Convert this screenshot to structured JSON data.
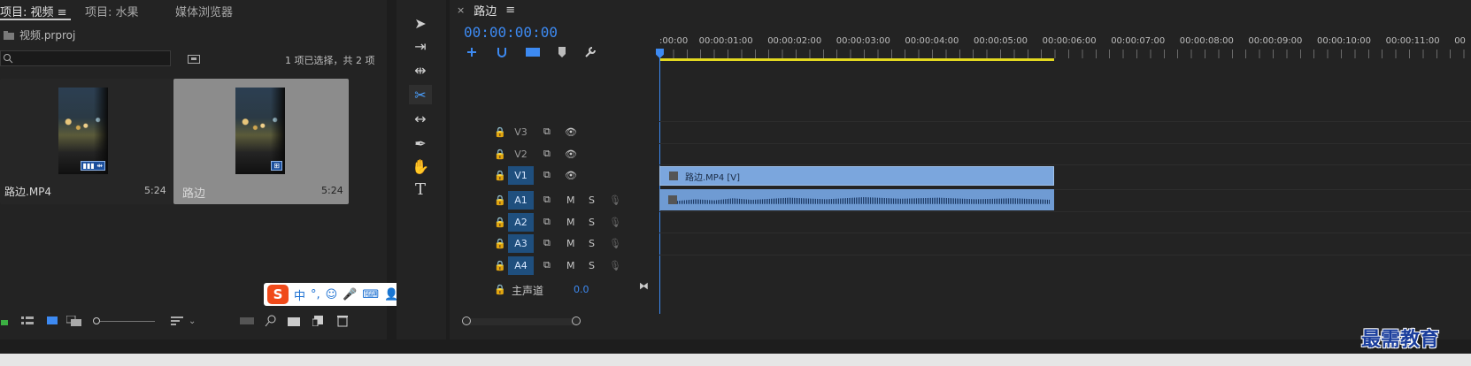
{
  "left_panel": {
    "tabs": [
      {
        "label": "项目: 视频"
      },
      {
        "label": "项目: 水果"
      },
      {
        "label": "媒体浏览器"
      }
    ],
    "menu_glyph": "≡",
    "project_file": "视频.prproj",
    "selection_status": "1 项已选择，共 2 项",
    "items": [
      {
        "name": "路边.MP4",
        "duration": "5:24",
        "badge": "▮▮▮ ⇹"
      },
      {
        "name": "路边",
        "duration": "5:24",
        "badge": "⊞"
      }
    ]
  },
  "ime": {
    "items": [
      "中",
      "°,",
      "☺",
      "🎤",
      "⌨",
      "👤",
      "👕",
      "▦"
    ]
  },
  "timeline": {
    "sequence_name": "路边",
    "close_glyph": "×",
    "menu_glyph": "≡",
    "timecode": "00:00:00:00",
    "ruler_labels": [
      ":00:00",
      "00:00:01:00",
      "00:00:02:00",
      "00:00:03:00",
      "00:00:04:00",
      "00:00:05:00",
      "00:00:06:00",
      "00:00:07:00",
      "00:00:08:00",
      "00:00:09:00",
      "00:00:10:00",
      "00:00:11:00",
      "00"
    ],
    "video_tracks": [
      {
        "name": "V3",
        "active": false
      },
      {
        "name": "V2",
        "active": false
      },
      {
        "name": "V1",
        "active": true
      }
    ],
    "audio_tracks": [
      {
        "name": "A1"
      },
      {
        "name": "A2"
      },
      {
        "name": "A3"
      },
      {
        "name": "A4"
      }
    ],
    "mute_label": "M",
    "solo_label": "S",
    "master_label": "主声道",
    "master_value": "0.0",
    "video_clip_label": "路边.MP4 [V]"
  },
  "watermark": "最需教育",
  "colors": {
    "accent": "#3d8af2",
    "work_area": "#e3d820",
    "clip_video": "#7ba6dd",
    "clip_audio": "#6f9bd3",
    "track_active": "#1f4f7e"
  }
}
